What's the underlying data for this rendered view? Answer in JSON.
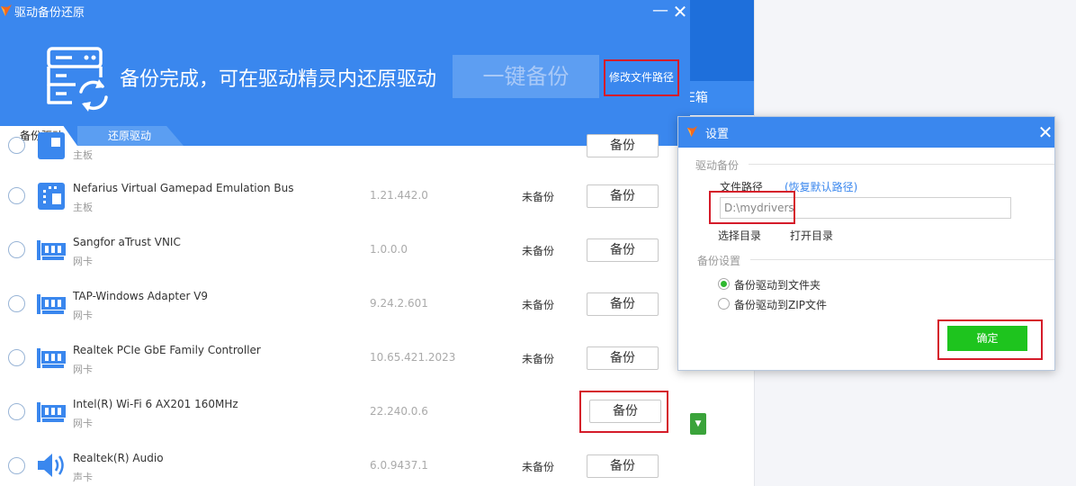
{
  "colors": {
    "header_blue": "#3a87ee",
    "highlight_red": "#d51c2a",
    "ok_green": "#1ec41e",
    "link_blue": "#3a87ee"
  },
  "window": {
    "title": "驱动备份还原",
    "minimize_icon": "minimize-icon",
    "close_icon": "close-icon"
  },
  "header": {
    "message": "备份完成，可在驱动精灵内还原驱动",
    "one_key_button": "一键备份",
    "change_path_link": "修改文件路径"
  },
  "tabs": [
    {
      "label": "备份驱动",
      "active": true
    },
    {
      "label": "还原驱动",
      "active": false
    }
  ],
  "devices": [
    {
      "name": "",
      "category": "主板",
      "version": "",
      "status": "",
      "button": "备份",
      "icon": "motherboard-icon",
      "partial": true
    },
    {
      "name": "Nefarius Virtual Gamepad Emulation Bus",
      "category": "主板",
      "version": "1.21.442.0",
      "status": "未备份",
      "button": "备份",
      "icon": "motherboard-icon"
    },
    {
      "name": "Sangfor aTrust VNIC",
      "category": "网卡",
      "version": "1.0.0.0",
      "status": "未备份",
      "button": "备份",
      "icon": "network-card-icon"
    },
    {
      "name": "TAP-Windows Adapter V9",
      "category": "网卡",
      "version": "9.24.2.601",
      "status": "未备份",
      "button": "备份",
      "icon": "network-card-icon"
    },
    {
      "name": "Realtek PCIe GbE Family Controller",
      "category": "网卡",
      "version": "10.65.421.2023",
      "status": "未备份",
      "button": "备份",
      "icon": "network-card-icon"
    },
    {
      "name": "Intel(R) Wi-Fi 6 AX201 160MHz",
      "category": "网卡",
      "version": "22.240.0.6",
      "status": "",
      "button": "备份",
      "icon": "network-card-icon",
      "highlighted": true
    },
    {
      "name": "Realtek(R) Audio",
      "category": "声卡",
      "version": "6.0.9437.1",
      "status": "未备份",
      "button": "备份",
      "icon": "speaker-icon"
    }
  ],
  "background_app": {
    "tab_fragment": "E箱"
  },
  "settings_dialog": {
    "title": "设置",
    "section_driver_backup": "驱动备份",
    "file_path_label": "文件路径",
    "restore_default_link": "(恢复默认路径)",
    "path_value": "D:\\mydrivers",
    "select_dir": "选择目录",
    "open_dir": "打开目录",
    "section_backup_settings": "备份设置",
    "option_folder": "备份驱动到文件夹",
    "option_zip": "备份驱动到ZIP文件",
    "selected_option": "folder",
    "ok_button": "确定"
  }
}
